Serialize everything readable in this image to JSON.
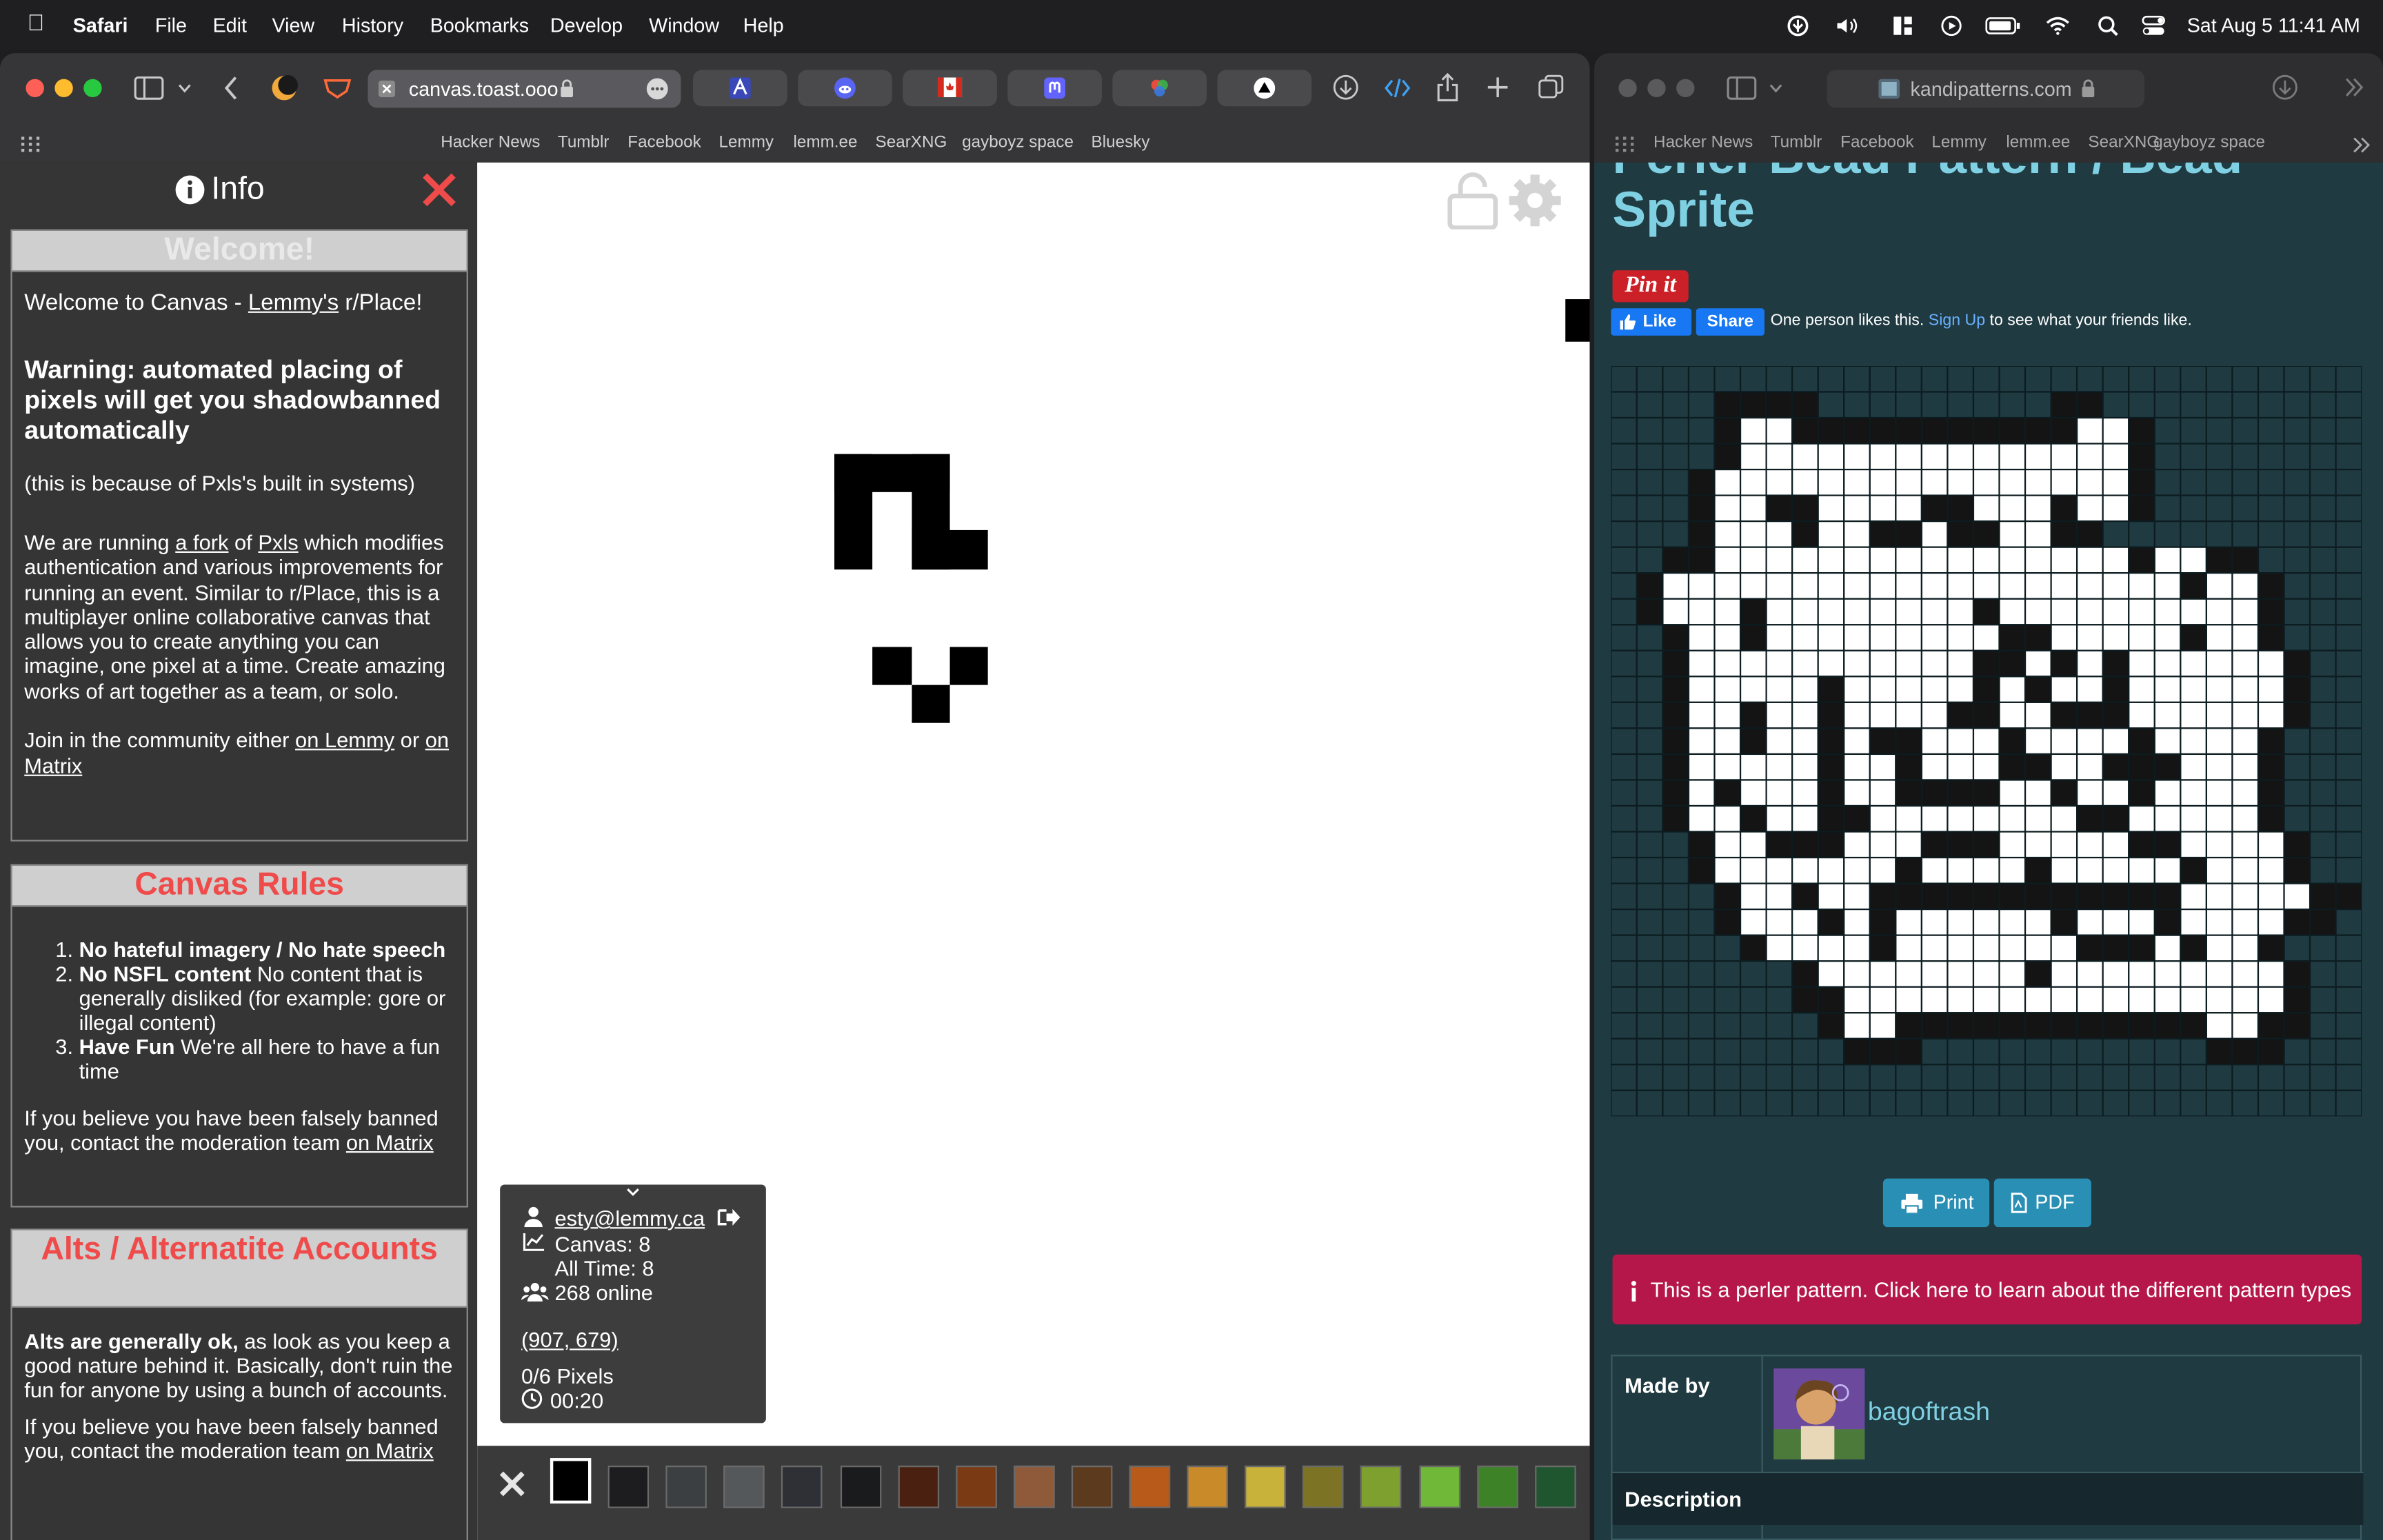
{
  "menubar": {
    "app": "Safari",
    "items": [
      "File",
      "Edit",
      "View",
      "History",
      "Bookmarks",
      "Develop",
      "Window",
      "Help"
    ],
    "datetime": "Sat Aug 5  11:41 AM"
  },
  "left_window": {
    "url": "canvas.toast.ooo",
    "favorites": [
      "Hacker News",
      "Tumblr",
      "Facebook",
      "Lemmy",
      "lemm.ee",
      "SearXNG",
      "gayboyz space",
      "Bluesky"
    ]
  },
  "right_window": {
    "url": "kandipatterns.com",
    "favorites": [
      "Hacker News",
      "Tumblr",
      "Facebook",
      "Lemmy",
      "lemm.ee",
      "SearXNG",
      "gayboyz space"
    ]
  },
  "sidebar": {
    "title": "Info",
    "welcome": {
      "heading": "Welcome!",
      "intro_pre": "Welcome to Canvas - ",
      "intro_link": "Lemmy's",
      "intro_post": " r/Place!",
      "warning": "Warning: automated placing of pixels will get you shadowbanned automatically",
      "reason": "(this is because of Pxls's built in systems)",
      "running_pre": "We are running ",
      "running_link1": "a fork",
      "running_mid": " of ",
      "running_link2": "Pxls",
      "running_post": " which modifies authentication and various improvements for running an event. Similar to r/Place, this is a multiplayer online collaborative canvas that allows you to create anything you can imagine, one pixel at a time. Create amazing works of art together as a team, or solo.",
      "join_pre": "Join in the community either ",
      "join_link1": "on Lemmy",
      "join_mid": " or ",
      "join_link2": "on Matrix"
    },
    "rules": {
      "heading": "Canvas Rules",
      "items": [
        {
          "bold": "No hateful imagery / No hate speech",
          "text": ""
        },
        {
          "bold": "No NSFL content",
          "text": " No content that is generally disliked (for example: gore or illegal content)"
        },
        {
          "bold": "Have Fun",
          "text": " We're all here to have a fun time"
        }
      ],
      "banned_pre": "If you believe you have been falsely banned you, contact the moderation team ",
      "banned_link": "on Matrix"
    },
    "alts": {
      "heading": "Alts / Alternatite Accounts",
      "bold": "Alts are generally ok,",
      "text": " as look as you keep a good nature behind it. Basically, don't ruin the fun for anyone by using a bunch of accounts.",
      "banned_pre": "If you believe you have been falsely banned you, contact the moderation team ",
      "banned_link": "on Matrix"
    }
  },
  "canvas_info": {
    "user": "esty@lemmy.ca",
    "canvas_count": "Canvas: 8",
    "all_time": "All Time: 8",
    "online": "268 online",
    "coords": "(907, 679)",
    "pixels": "0/6 Pixels",
    "timer": "00:20"
  },
  "palette_colors": [
    "#000000",
    "#1d1d1f",
    "#3c3f41",
    "#55585b",
    "#2e3035",
    "#1a1b1c",
    "#4a2110",
    "#7a3a14",
    "#8f5a3a",
    "#5c3a1e",
    "#b85a1a",
    "#c98a2a",
    "#c9b23a",
    "#7c7424",
    "#7ea02e",
    "#6fb838",
    "#3e8228",
    "#1f5630"
  ],
  "kandi": {
    "title_line1": "Perler Bead Pattern / Bead",
    "title_line2": "Sprite",
    "pin_label": "Pin it",
    "like_label": "Like",
    "share_label": "Share",
    "like_text_pre": "One person likes this. ",
    "signup_link": "Sign Up",
    "like_text_post": " to see what your friends like.",
    "print_label": "Print",
    "pdf_label": "PDF",
    "notice": "This is a perler pattern. Click here to learn about the different pattern types",
    "made_by_label": "Made by",
    "author": "bagoftrash",
    "description_label": "Description"
  }
}
